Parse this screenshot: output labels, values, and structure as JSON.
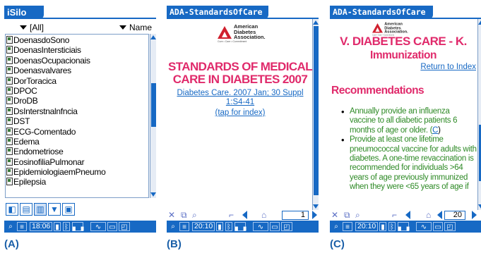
{
  "labels": {
    "a": "(A)",
    "b": "(B)",
    "c": "(C)"
  },
  "isilo": {
    "title": "iSilo",
    "filter_selected": "[All]",
    "sort_selected": "Name",
    "items": [
      "DoenasdoSono",
      "DoenasIntersticiais",
      "DoenasOcupacionais",
      "Doenasvalvares",
      "DorToracica",
      "DPOC",
      "DroDB",
      "DsInterstnalnfncia",
      "DST",
      "ECG-Comentado",
      "Edema",
      "Endometriose",
      "EosinofiliaPulmonar",
      "EpidemiologiaemPneumo",
      "Epilepsia"
    ],
    "time": "18:06"
  },
  "doc_b": {
    "title": "ADA-StandardsOfCare",
    "logo_text": "American\nDiabetes\nAssociation.",
    "logo_tagline": "Cure • Care • Commitment",
    "heading_line1": "STANDARDS OF MEDICAL",
    "heading_line2": "CARE IN DIABETES 2007",
    "citation_line1": "Diabetes Care. 2007 Jan; 30 Suppl",
    "citation_line2": "1:S4-41",
    "tap_hint": "(tap for index)",
    "page": "1",
    "time": "20:10"
  },
  "doc_c": {
    "title": "ADA-StandardsOfCare",
    "logo_text": "American\nDiabetes\nAssociation.",
    "logo_tagline": "Cure • Care • Commitment",
    "heading_line1": "V. DIABETES CARE - K.",
    "heading_line2": "Immunization",
    "return_link": "Return to Index",
    "section": "Recommendations",
    "bullet1": "Annually provide an influenza vaccine to all diabetic patients 6 months of age or older. (",
    "bullet1_ref": "C",
    "bullet1_end": ")",
    "bullet2": "Provide at least one lifetime pneumococcal vaccine for adults with diabetes. A one-time revaccination is recommended for individuals >64 years of age previously immunized when they were <65 years of age if",
    "page": "20",
    "time": "20:10"
  },
  "colors": {
    "accent": "#1769c4",
    "heading": "#e02a6b",
    "bullet_text": "#2e8a26"
  }
}
